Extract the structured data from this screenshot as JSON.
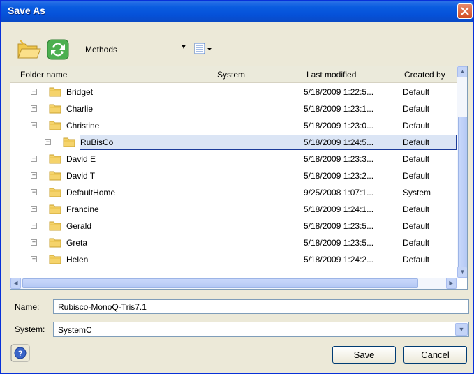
{
  "dialog": {
    "title": "Save As"
  },
  "toolbar": {
    "folder_combo_value": "Methods",
    "icons": [
      "open-folder-icon",
      "refresh-icon",
      "view-menu-icon"
    ]
  },
  "list": {
    "columns": [
      "Folder name",
      "System",
      "Last modified",
      "Created by"
    ],
    "rows": [
      {
        "name": "Bridget",
        "modified": "5/18/2009 1:22:5...",
        "created": "Default",
        "expander": "+",
        "level": 0
      },
      {
        "name": "Charlie",
        "modified": "5/18/2009 1:23:1...",
        "created": "Default",
        "expander": "+",
        "level": 0
      },
      {
        "name": "Christine",
        "modified": "5/18/2009 1:23:0...",
        "created": "Default",
        "expander": "−",
        "level": 0
      },
      {
        "name": "RuBisCo",
        "modified": "5/18/2009 1:24:5...",
        "created": "Default",
        "expander": "−",
        "level": 1,
        "selected": true
      },
      {
        "name": "David E",
        "modified": "5/18/2009 1:23:3...",
        "created": "Default",
        "expander": "+",
        "level": 0
      },
      {
        "name": "David T",
        "modified": "5/18/2009 1:23:2...",
        "created": "Default",
        "expander": "+",
        "level": 0
      },
      {
        "name": "DefaultHome",
        "modified": "9/25/2008 1:07:1...",
        "created": "System",
        "expander": "−",
        "level": 0
      },
      {
        "name": "Francine",
        "modified": "5/18/2009 1:24:1...",
        "created": "Default",
        "expander": "+",
        "level": 0
      },
      {
        "name": "Gerald",
        "modified": "5/18/2009 1:23:5...",
        "created": "Default",
        "expander": "+",
        "level": 0
      },
      {
        "name": "Greta",
        "modified": "5/18/2009 1:23:5...",
        "created": "Default",
        "expander": "+",
        "level": 0
      },
      {
        "name": "Helen",
        "modified": "5/18/2009 1:24:2...",
        "created": "Default",
        "expander": "+",
        "level": 0
      }
    ]
  },
  "form": {
    "name_label": "Name:",
    "name_value": "Rubisco-MonoQ-Tris7.1",
    "system_label": "System:",
    "system_value": "SystemC"
  },
  "buttons": {
    "save": "Save",
    "cancel": "Cancel"
  },
  "colors": {
    "titlebar": "#0551d8",
    "selection_border": "#1c3c9a",
    "folder": "#f5d36b"
  }
}
